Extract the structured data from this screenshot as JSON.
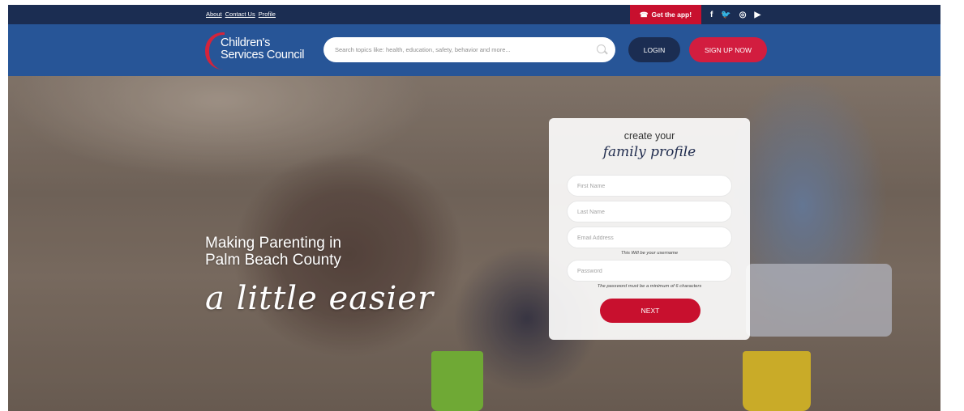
{
  "topbar": {
    "links": [
      "About",
      "Contact Us",
      "Profile"
    ],
    "get_app": "Get the app!",
    "social": [
      "f",
      "🐦",
      "◎",
      "▶"
    ]
  },
  "header": {
    "logo_line1": "Children's",
    "logo_line2": "Services Council",
    "search_placeholder": "Search topics like: health, education, safety, behavior and more...",
    "login": "LOGIN",
    "signup": "SIGN UP NOW"
  },
  "hero": {
    "line1": "Making Parenting in",
    "line2": "Palm Beach County",
    "line3": "a little easier"
  },
  "form": {
    "heading1": "create your",
    "heading2": "family profile",
    "first_name_placeholder": "First Name",
    "last_name_placeholder": "Last Name",
    "email_placeholder": "Email Address",
    "email_hint": "This Will be your username",
    "password_placeholder": "Password",
    "password_hint": "The password must be a minimum of 6 characters",
    "next": "NEXT"
  },
  "colors": {
    "navy": "#1b2d52",
    "header_blue": "#275597",
    "red": "#c8102e"
  }
}
